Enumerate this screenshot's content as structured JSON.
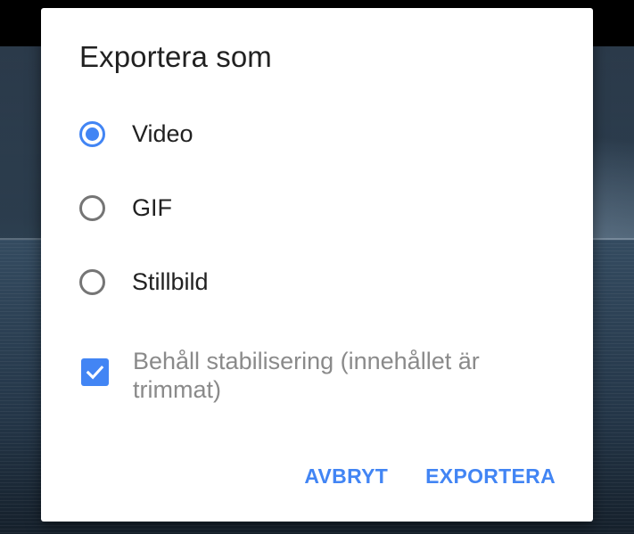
{
  "dialog": {
    "title": "Exportera som",
    "options": [
      {
        "label": "Video",
        "selected": true
      },
      {
        "label": "GIF",
        "selected": false
      },
      {
        "label": "Stillbild",
        "selected": false
      }
    ],
    "checkbox": {
      "label": "Behåll stabilisering (innehållet är trimmat)",
      "checked": true
    },
    "buttons": {
      "cancel": "AVBRYT",
      "export": "EXPORTERA"
    }
  },
  "colors": {
    "accent": "#4285f4",
    "title_text": "#212121",
    "disabled_text": "#8a8a8a",
    "radio_unchecked": "#757575"
  },
  "icons": {
    "radio_checked": "radio-button-checked-icon",
    "radio_unchecked": "radio-button-unchecked-icon",
    "checkbox_checked": "check-icon"
  }
}
